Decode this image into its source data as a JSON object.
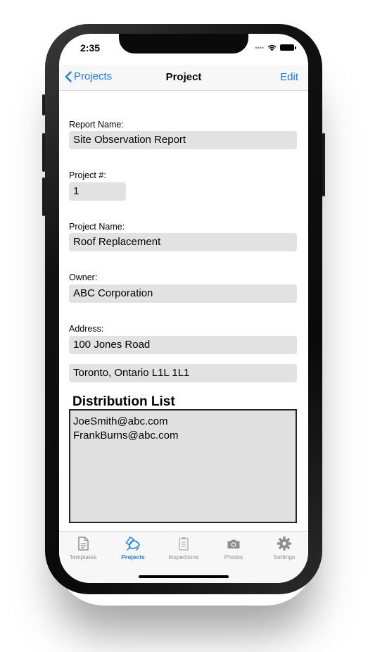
{
  "status_bar": {
    "time": "2:35"
  },
  "navbar": {
    "back_label": "Projects",
    "title": "Project",
    "edit_label": "Edit"
  },
  "form": {
    "report_name": {
      "label": "Report Name:",
      "value": "Site Observation Report"
    },
    "project_number": {
      "label": "Project #:",
      "value": "1"
    },
    "project_name": {
      "label": "Project Name:",
      "value": "Roof Replacement"
    },
    "owner": {
      "label": "Owner:",
      "value": "ABC Corporation"
    },
    "address": {
      "label": "Address:",
      "line1": "100 Jones Road",
      "line2": "Toronto, Ontario L1L 1L1"
    }
  },
  "distribution": {
    "title": "Distribution List",
    "emails": [
      "JoeSmith@abc.com",
      "FrankBurns@abc.com"
    ]
  },
  "tabbar": {
    "active": "Projects",
    "accent_color": "#1a7cf4",
    "tabs": [
      {
        "label": "Templates",
        "icon": "document-icon"
      },
      {
        "label": "Projects",
        "icon": "projects-icon"
      },
      {
        "label": "Inspections",
        "icon": "clipboard-icon"
      },
      {
        "label": "Photos",
        "icon": "camera-icon"
      },
      {
        "label": "Settings",
        "icon": "gear-icon"
      }
    ]
  }
}
